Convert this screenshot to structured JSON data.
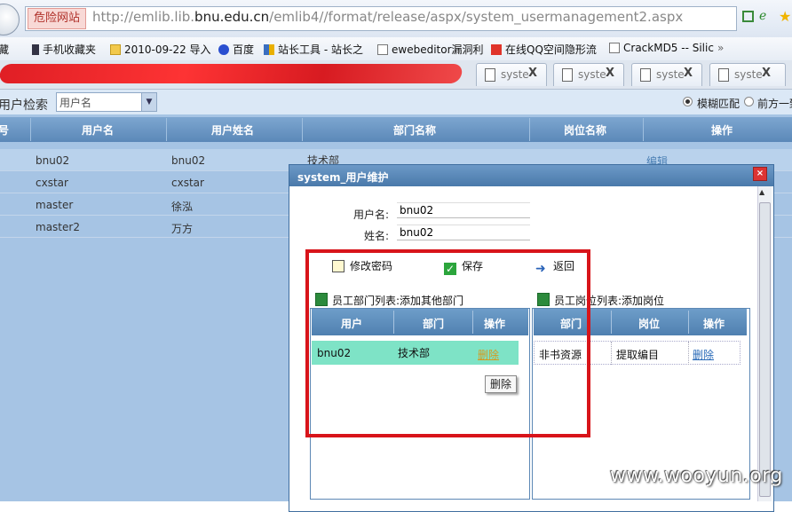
{
  "browser": {
    "danger_badge": "危险网站",
    "url_prefix": "http://emlib.lib.",
    "url_domain": "bnu.edu.cn",
    "url_suffix": "/emlib4//format/release/aspx/system_usermanagement2.aspx",
    "bookmarks": [
      {
        "label": "藏",
        "icon": "bookmark-star-icon"
      },
      {
        "label": "手机收藏夹",
        "icon": "phone-icon"
      },
      {
        "label": "2010-09-22 导入",
        "icon": "folder-icon"
      },
      {
        "label": "百度",
        "icon": "baidu-paw-icon"
      },
      {
        "label": "站长工具 - 站长之",
        "icon": "site-tools-icon"
      },
      {
        "label": "ewebeditor漏洞利",
        "icon": "page-icon"
      },
      {
        "label": "在线QQ空间隐形流",
        "icon": "gift-icon"
      },
      {
        "label": "CrackMD5 -- Silic",
        "icon": "page-icon"
      },
      {
        "label": "»",
        "icon": "more-icon"
      }
    ],
    "tabs": [
      {
        "title": "syste",
        "close": "X"
      },
      {
        "title": "syste",
        "close": "X"
      },
      {
        "title": "syste",
        "close": "X"
      },
      {
        "title": "syste",
        "close": "X"
      }
    ]
  },
  "search": {
    "label": "用户检索",
    "select_value": "用户名",
    "radio_fuzzy": "模糊匹配",
    "radio_prefix": "前方一致"
  },
  "grid": {
    "headers": [
      "号",
      "用户名",
      "用户姓名",
      "部门名称",
      "岗位名称",
      "操作"
    ],
    "rows": [
      {
        "username": "bnu02",
        "name": "bnu02",
        "dept": "技术部",
        "op": "编辑"
      },
      {
        "username": "cxstar",
        "name": "cxstar",
        "dept": "",
        "op": ""
      },
      {
        "username": "master",
        "name": "徐泓",
        "dept": "",
        "op": ""
      },
      {
        "username": "master2",
        "name": "万方",
        "dept": "",
        "op": ""
      }
    ]
  },
  "dialog": {
    "title": "system_用户维护",
    "close": "×",
    "username_label": "用户名:",
    "username_value": "bnu02",
    "fullname_label": "姓名:",
    "fullname_value": "bnu02",
    "actions": {
      "change_password": "修改密码",
      "save": "保存",
      "back": "返回"
    },
    "dept_list": {
      "title": "员工部门列表:",
      "add_link": "添加其他部门",
      "headers": [
        "用户",
        "部门",
        "操作"
      ],
      "rows": [
        {
          "user": "bnu02",
          "dept": "技术部",
          "op": "删除"
        }
      ],
      "tooltip": "删除"
    },
    "post_list": {
      "title": "员工岗位列表:",
      "add_link": "添加岗位",
      "headers": [
        "部门",
        "岗位",
        "操作"
      ],
      "rows": [
        {
          "dept": "非书资源",
          "post": "提取编目",
          "op": "删除"
        }
      ]
    }
  },
  "watermark": "www.wooyun.org",
  "colors": {
    "danger": "#b0312a",
    "header_blue": "#5b88b8",
    "highlight_red": "#d8141a",
    "row_green": "#7ee3c6"
  }
}
